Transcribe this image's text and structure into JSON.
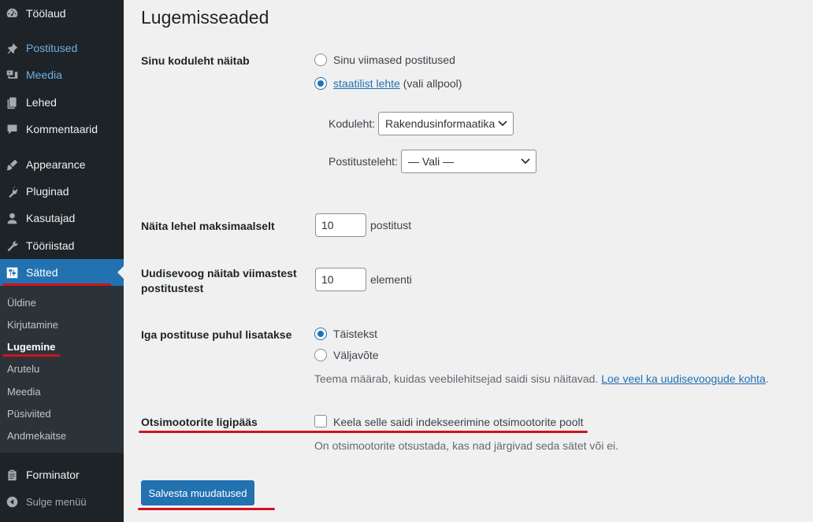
{
  "sidebar": {
    "items": [
      {
        "label": "Töölaud",
        "icon": "dashboard-icon"
      },
      {
        "label": "Postitused",
        "icon": "pin-icon"
      },
      {
        "label": "Meedia",
        "icon": "media-icon"
      },
      {
        "label": "Lehed",
        "icon": "pages-icon"
      },
      {
        "label": "Kommentaarid",
        "icon": "comment-icon"
      },
      {
        "label": "Appearance",
        "icon": "brush-icon"
      },
      {
        "label": "Pluginad",
        "icon": "plugin-icon"
      },
      {
        "label": "Kasutajad",
        "icon": "user-icon"
      },
      {
        "label": "Tööriistad",
        "icon": "wrench-icon"
      },
      {
        "label": "Sätted",
        "icon": "settings-icon"
      },
      {
        "label": "Forminator",
        "icon": "clipboard-icon"
      },
      {
        "label": "Sulge menüü",
        "icon": "collapse-icon"
      }
    ],
    "submenu": [
      "Üldine",
      "Kirjutamine",
      "Lugemine",
      "Arutelu",
      "Meedia",
      "Püsiviited",
      "Andmekaitse"
    ]
  },
  "page": {
    "title": "Lugemisseaded",
    "homepage_displays": {
      "label": "Sinu koduleht näitab",
      "option_latest": "Sinu viimased postitused",
      "option_static_link": "staatilist lehte",
      "option_static_rest": " (vali allpool)",
      "homepage_label": "Koduleht:",
      "homepage_value": "Rakendusinformaatika",
      "postspage_label": "Postitusteleht:",
      "postspage_value": "— Vali —"
    },
    "posts_per_page": {
      "label": "Näita lehel maksimaalselt",
      "value": "10",
      "suffix": "postitust"
    },
    "feed_items": {
      "label_line1": "Uudisevoog näitab viimastest",
      "label_line2": "postitustest",
      "value": "10",
      "suffix": "elementi"
    },
    "feed_content": {
      "label": "Iga postituse puhul lisatakse",
      "option_full": "Täistekst",
      "option_excerpt": "Väljavõte",
      "desc_text": "Teema määrab, kuidas veebilehitsejad saidi sisu näitavad.",
      "desc_link": "Loe veel ka uudisevoogude kohta",
      "desc_end": "."
    },
    "search_visibility": {
      "label": "Otsimootorite ligipääs",
      "checkbox_label": "Keela selle saidi indekseerimine otsimootorite poolt",
      "desc": "On otsimootorite otsustada, kas nad järgivad seda sätet või ei."
    },
    "save_label": "Salvesta muudatused"
  },
  "colors": {
    "accent": "#2271b1",
    "sidebar_bg": "#1d2327",
    "submenu_bg": "#2c3338",
    "annotation_red": "#d0131c",
    "background": "#f0f0f1"
  }
}
